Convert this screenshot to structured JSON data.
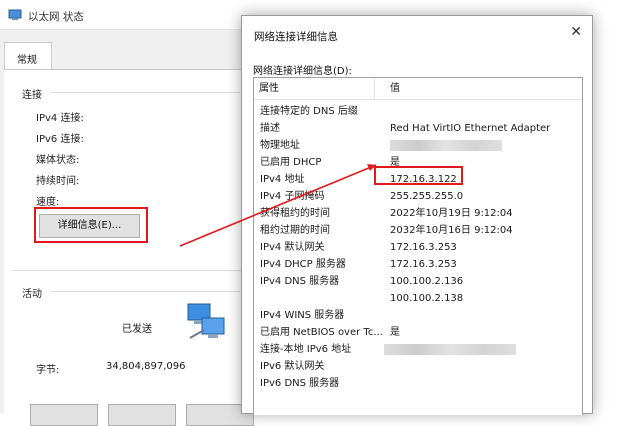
{
  "status_window": {
    "title": "以太网 状态",
    "tab": "常规",
    "connection_section": "连接",
    "labels": [
      "IPv4 连接:",
      "IPv6 连接:",
      "媒体状态:",
      "持续时间:",
      "速度:"
    ],
    "details_button": "详细信息(E)...",
    "activity_section": "活动",
    "sent_label": "已发送",
    "bytes_label": "字节:",
    "bytes_value": "34,804,897,096"
  },
  "details_dialog": {
    "title": "网络连接详细信息",
    "close_glyph": "✕",
    "caption": "网络连接详细信息(D):",
    "columns": {
      "property": "属性",
      "value": "值"
    },
    "rows": [
      {
        "property": "连接特定的 DNS 后缀",
        "value": ""
      },
      {
        "property": "描述",
        "value": "Red Hat VirtIO Ethernet Adapter"
      },
      {
        "property": "物理地址",
        "value": ""
      },
      {
        "property": "已启用 DHCP",
        "value": "是"
      },
      {
        "property": "IPv4 地址",
        "value": "172.16.3.122"
      },
      {
        "property": "IPv4 子网掩码",
        "value": "255.255.255.0"
      },
      {
        "property": "获得租约的时间",
        "value": "2022年10月19日 9:12:04"
      },
      {
        "property": "租约过期的时间",
        "value": "2032年10月16日 9:12:04"
      },
      {
        "property": "IPv4 默认网关",
        "value": "172.16.3.253"
      },
      {
        "property": "IPv4 DHCP 服务器",
        "value": "172.16.3.253"
      },
      {
        "property": "IPv4 DNS 服务器",
        "value": "100.100.2.136"
      },
      {
        "property": "",
        "value": "100.100.2.138"
      },
      {
        "property": "IPv4 WINS 服务器",
        "value": ""
      },
      {
        "property": "已启用 NetBIOS over Tc...",
        "value": "是"
      },
      {
        "property": "连接-本地 IPv6 地址",
        "value": ""
      },
      {
        "property": "IPv6 默认网关",
        "value": ""
      },
      {
        "property": "IPv6 DNS 服务器",
        "value": ""
      }
    ]
  },
  "colors": {
    "highlight": "#e2191c",
    "button_face": "#e1e1e1",
    "window_bg": "#f0f0f0"
  },
  "icons": [
    "network-adapter-icon",
    "close-icon",
    "computers-activity-icon"
  ]
}
